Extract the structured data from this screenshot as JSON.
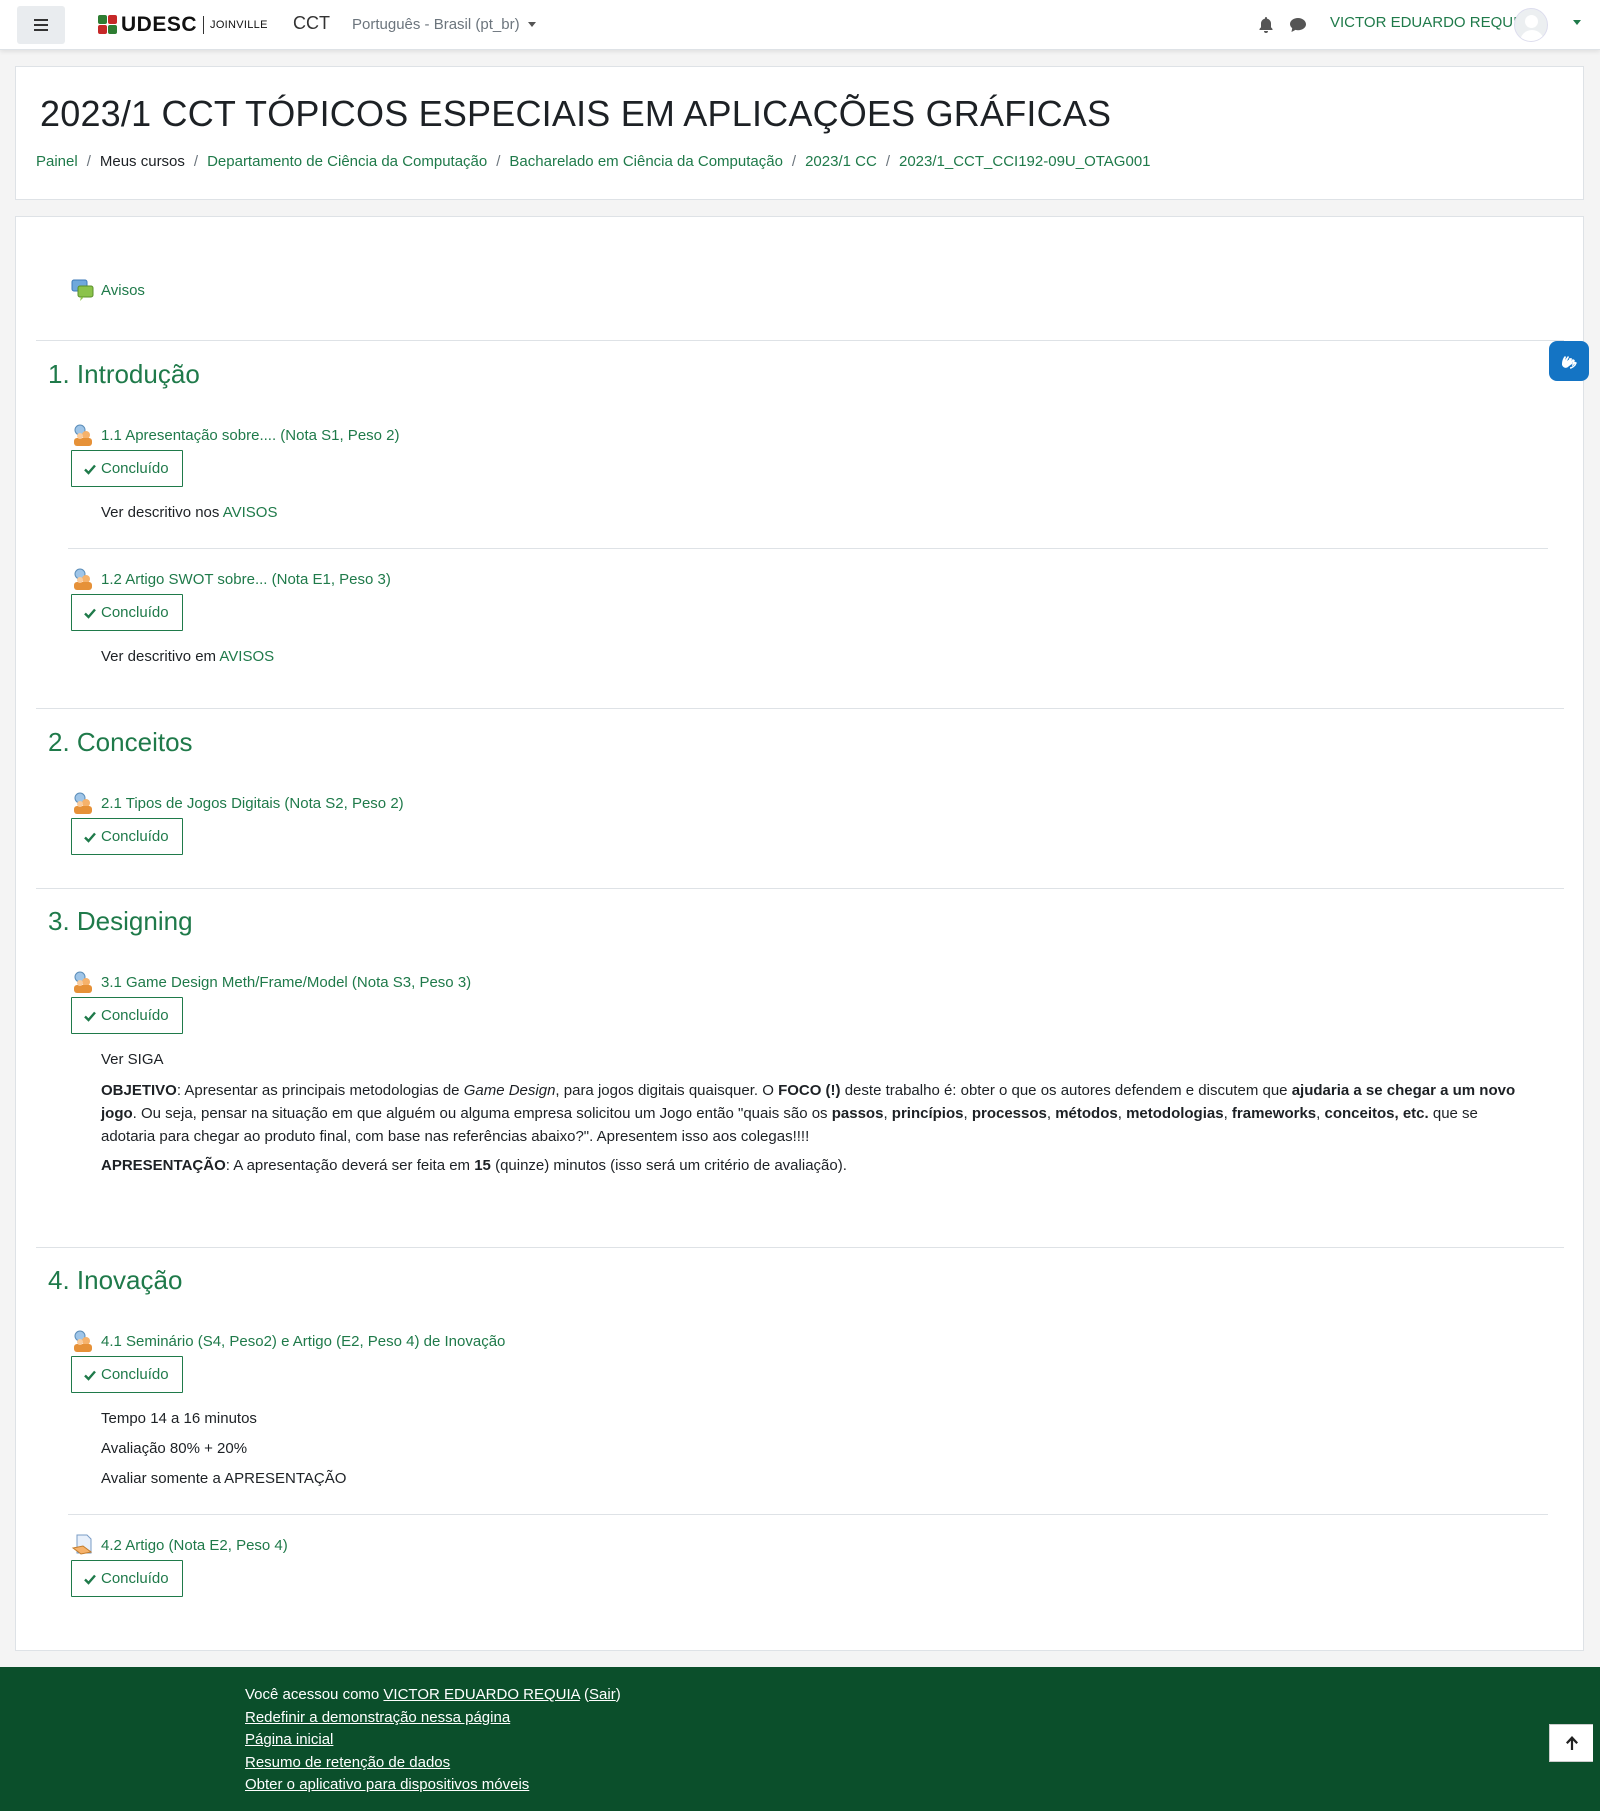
{
  "navbar": {
    "menu_icon": "hamburger-icon",
    "logo_text": "UDESC",
    "logo_sub": "JOINVILLE",
    "site_name": "CCT",
    "language": "Português - Brasil (pt_br)",
    "user_name": "VICTOR EDUARDO REQUIA",
    "colors": {
      "brand_green": "#1f7a4a",
      "footer_green": "#0b4f2b"
    }
  },
  "header": {
    "title": "2023/1 CCT TÓPICOS ESPECIAIS EM APLICAÇÕES GRÁFICAS",
    "breadcrumb": [
      "Painel",
      "Meus cursos",
      "Departamento de Ciência da Computação",
      "Bacharelado em Ciência da Computação",
      "2023/1 CC",
      "2023/1_CCT_CCI192-09U_OTAG001"
    ]
  },
  "course": {
    "announcements": "Avisos",
    "done_label": "Concluído",
    "sections": [
      {
        "title": "1. Introdução",
        "activities": [
          {
            "name": "1.1 Apresentação sobre.... (Nota S1, Peso 2)",
            "desc_prefix": "Ver descritivo nos ",
            "desc_link": "AVISOS"
          },
          {
            "name": "1.2 Artigo SWOT sobre... (Nota E1, Peso 3)",
            "desc_prefix": "Ver descritivo em ",
            "desc_link": "AVISOS"
          }
        ]
      },
      {
        "title": "2. Conceitos",
        "activities": [
          {
            "name": "2.1 Tipos de Jogos Digitais (Nota S2, Peso 2)"
          }
        ]
      },
      {
        "title": "3. Designing",
        "activities": [
          {
            "name": "3.1 Game Design Meth/Frame/Model (Nota S3, Peso 3)",
            "ver_siga": "Ver SIGA",
            "obj": {
              "label": "OBJETIVO",
              "t1": ": Apresentar as principais metodologias de ",
              "gd": "Game Design",
              "t2": ", para jogos digitais quaisquer. O ",
              "foco": "FOCO (!)",
              "t3": " deste trabalho é: obter o que os autores defendem e discutem que ",
              "ajud": "ajudaria a se chegar a um novo jogo",
              "t4": ". Ou seja, pensar na situação em que alguém ou alguma empresa solicitou um Jogo então \"quais são os ",
              "passos": "passos",
              "c1": ", ",
              "princ": "princípios",
              "c2": ", ",
              "proc": "processos",
              "c3": ", ",
              "met": "métodos",
              "c4": ", ",
              "metod": "metodologias",
              "c5": ", ",
              "frame": "frameworks",
              "c6": ", ",
              "conc": "conceitos, etc.",
              "t5": " que se adotaria para chegar ao produto final, com base nas referências abaixo?\". Apresentem isso aos colegas!!!!"
            },
            "apres": {
              "label": "APRESENTAÇÃO",
              "t1": ": A apresentação deverá ser feita em ",
              "num": "15",
              "t2": " (quinze) minutos (isso será um critério de avaliação)."
            }
          }
        ]
      },
      {
        "title": "4. Inovação",
        "activities": [
          {
            "name": "4.1 Seminário (S4, Peso2) e Artigo (E2, Peso 4) de Inovação",
            "lines": [
              "Tempo 14 a 16 minutos",
              "Avaliação 80% + 20%",
              "Avaliar somente a APRESENTAÇÃO"
            ]
          },
          {
            "name": "4.2 Artigo (Nota E2, Peso 4)"
          }
        ]
      }
    ]
  },
  "footer": {
    "logged_prefix": "Você acessou como ",
    "user": "VICTOR EDUARDO REQUIA",
    "logout": "Sair",
    "links": [
      "Redefinir a demonstração nessa página",
      "Página inicial",
      "Resumo de retenção de dados",
      "Obter o aplicativo para dispositivos móveis"
    ]
  }
}
